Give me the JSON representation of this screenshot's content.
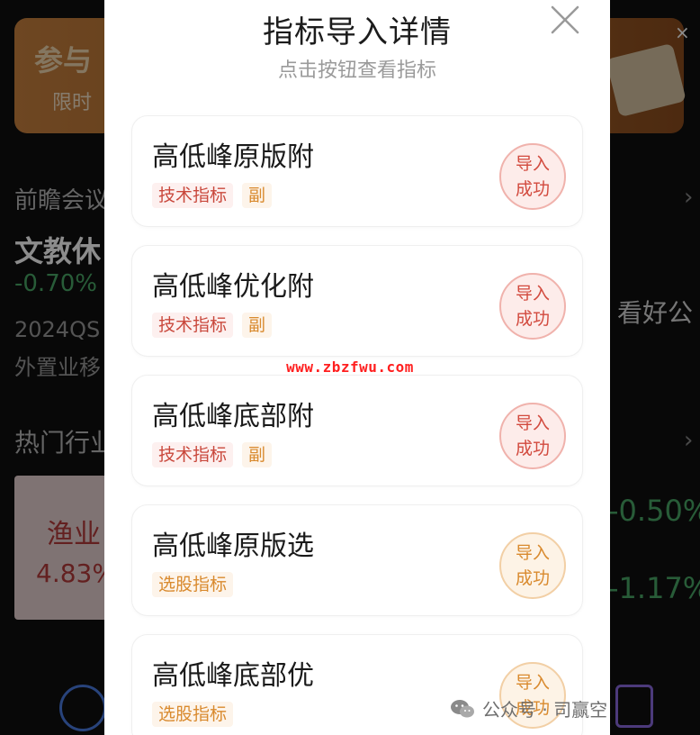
{
  "background": {
    "banner_title": "参与",
    "banner_subtitle": "限时",
    "banner_close": "×",
    "meeting_label": "前瞻会议",
    "industry_name": "文教休",
    "industry_change": "-0.70%",
    "watch_label": "看好公",
    "info_line1": "2024QS",
    "info_line2": "外置业移",
    "hot_section_label": "热门行业",
    "card_name": "渔业",
    "card_value": "4.83%",
    "right_value_1": "-0.50%",
    "right_value_2": "-1.17%",
    "chevron": "›"
  },
  "modal": {
    "title": "指标导入详情",
    "subtitle": "点击按钮查看指标",
    "items": [
      {
        "name": "高低峰原版附",
        "tags": [
          "技术指标",
          "副"
        ],
        "stamp_line1": "导入",
        "stamp_line2": "成功",
        "accent": "#d24a3e"
      },
      {
        "name": "高低峰优化附",
        "tags": [
          "技术指标",
          "副"
        ],
        "stamp_line1": "导入",
        "stamp_line2": "成功",
        "accent": "#d24a3e"
      },
      {
        "name": "高低峰底部附",
        "tags": [
          "技术指标",
          "副"
        ],
        "stamp_line1": "导入",
        "stamp_line2": "成功",
        "accent": "#d24a3e"
      },
      {
        "name": "高低峰原版选",
        "tags": [
          "选股指标"
        ],
        "stamp_line1": "导入",
        "stamp_line2": "成功",
        "accent": "#d98a2e"
      },
      {
        "name": "高低峰底部优",
        "tags": [
          "选股指标"
        ],
        "stamp_line1": "导入",
        "stamp_line2": "成功",
        "accent": "#d98a2e"
      }
    ]
  },
  "overlay": {
    "watermark": "www.zbzfwu.com",
    "credit": "公众号 · 司赢空"
  },
  "icons": {
    "close": "close-icon",
    "wechat": "wechat-icon"
  }
}
